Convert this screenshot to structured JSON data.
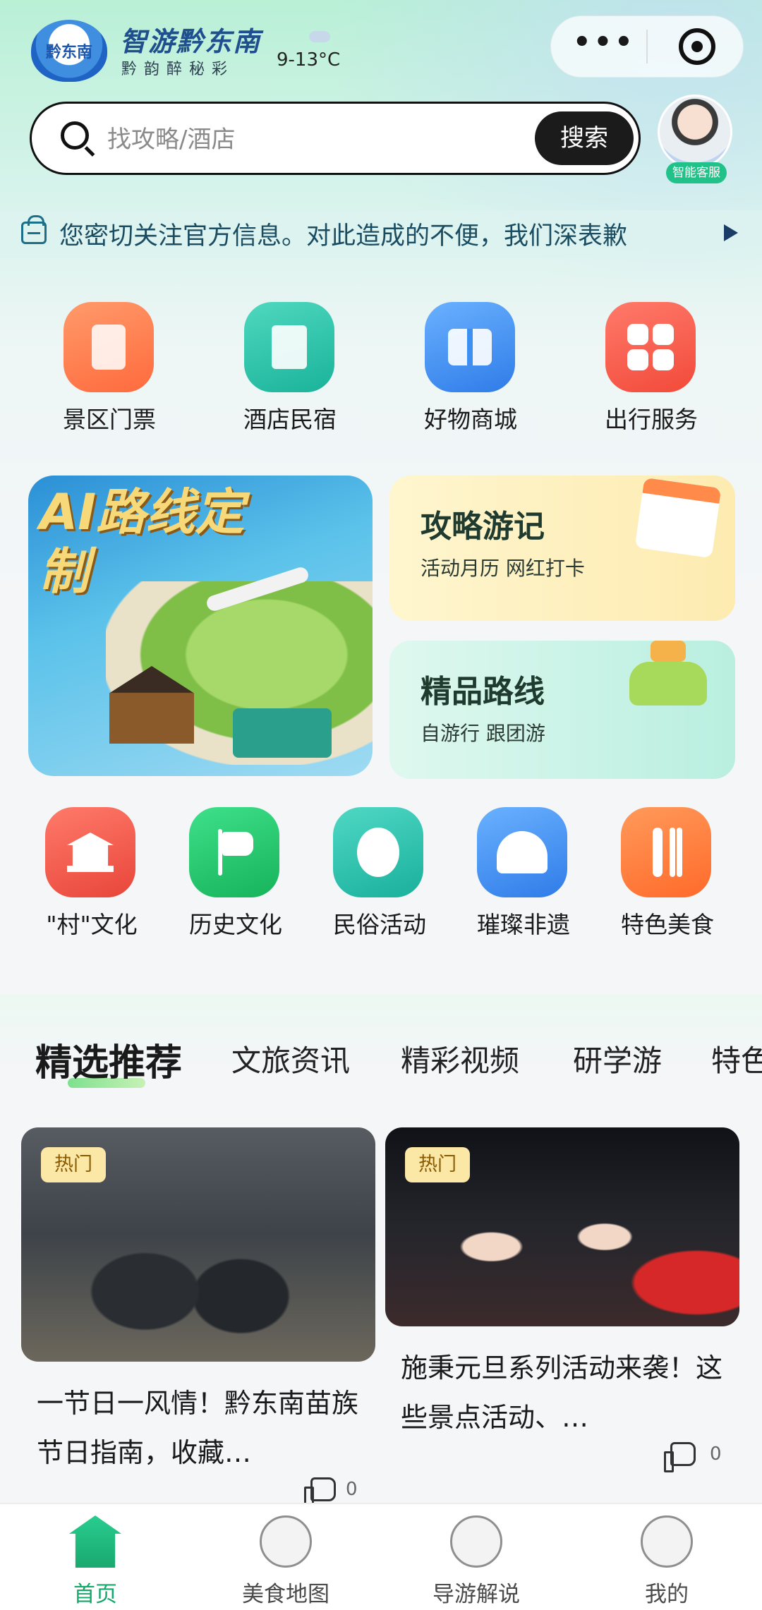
{
  "header": {
    "app_name": "智游黔东南",
    "tagline": "黔韵醉秘彩",
    "logo_text": "黔东南",
    "weather": "9-13°C",
    "weather_icon": "cloud-icon",
    "more_icon": "more-dots-icon",
    "close_icon": "target-icon"
  },
  "search": {
    "placeholder": "找攻略/酒店",
    "button_label": "搜索",
    "service_label": "智能客服"
  },
  "notice": {
    "text": "您密切关注官方信息。对此造成的不便，我们深表歉",
    "icon": "notice-icon"
  },
  "quick_links": [
    {
      "label": "景区门票",
      "color": "#ff7a4a"
    },
    {
      "label": "酒店民宿",
      "color": "#27c2a6"
    },
    {
      "label": "好物商城",
      "color": "#3e8ff2"
    },
    {
      "label": "出行服务",
      "color": "#ff5a4a"
    }
  ],
  "features": {
    "ai_title": "AI路线定制",
    "guide": {
      "title": "攻略游记",
      "subtitle": "活动月历 网红打卡"
    },
    "route": {
      "title": "精品路线",
      "subtitle": "自游行 跟团游"
    }
  },
  "culture": [
    {
      "label": "\"村\"文化",
      "color": "#f0584a"
    },
    {
      "label": "历史文化",
      "color": "#22c46a"
    },
    {
      "label": "民俗活动",
      "color": "#22bfa8"
    },
    {
      "label": "璀璨非遗",
      "color": "#3e8ff2"
    },
    {
      "label": "特色美食",
      "color": "#ff7a3a"
    }
  ],
  "tabs": [
    "精选推荐",
    "文旅资讯",
    "精彩视频",
    "研学游",
    "特色"
  ],
  "news": [
    {
      "badge": "热门",
      "title": "一节日一风情！黔东南苗族节日指南，收藏…",
      "likes": "0"
    },
    {
      "badge": "热门",
      "title": "施秉元旦系列活动来袭！这些景点活动、…",
      "likes": "0"
    }
  ],
  "bottom_nav": [
    {
      "label": "首页",
      "active": true
    },
    {
      "label": "美食地图",
      "active": false
    },
    {
      "label": "导游解说",
      "active": false
    },
    {
      "label": "我的",
      "active": false
    }
  ]
}
